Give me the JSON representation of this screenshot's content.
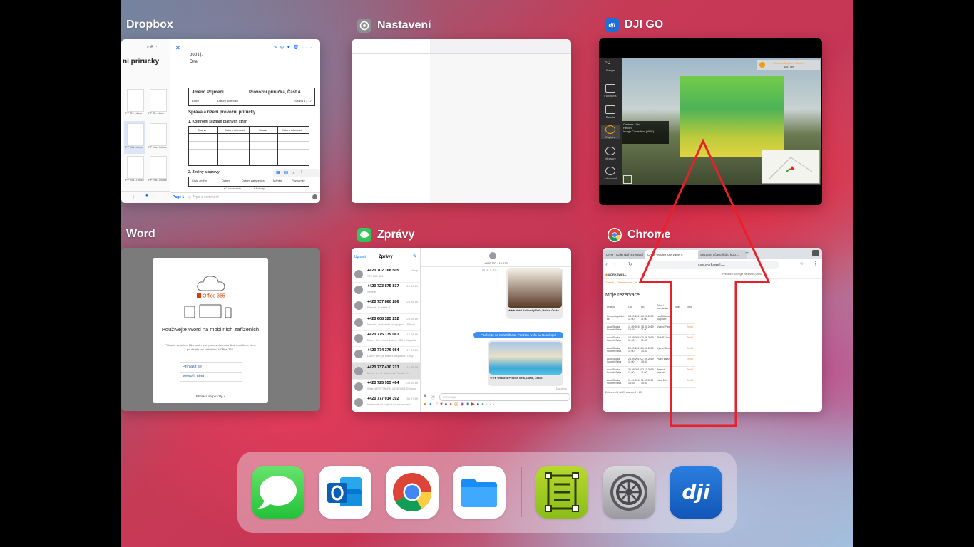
{
  "switcher": {
    "apps": [
      {
        "label": "Dropbox"
      },
      {
        "label": "Nastavení"
      },
      {
        "label": "DJI GO"
      },
      {
        "label": "Word"
      },
      {
        "label": "Zprávy"
      },
      {
        "label": "Chrome"
      }
    ]
  },
  "dropbox": {
    "folder_title": "ni prirucky",
    "field_podpis": "pod t.j.",
    "field_dne": "Dne",
    "doc_header_name": "Jméno Příjmení",
    "doc_header_title": "Provozní příručka, Část A",
    "doc_row_edition": "Edice",
    "doc_row_date": "Datum účinnosti",
    "doc_row_page": "Strana 1 z 17",
    "section_title": "Správa a řízení provozní příručky",
    "item_1": "1.     Kontrolní seznam platných stran",
    "table_headers": [
      "Strana",
      "Datum účinnosti",
      "Strana",
      "Datum účinnosti"
    ],
    "item_2": "2.     Změny a opravy",
    "table2_headers": [
      "Číslo změny",
      "Datum",
      "Datum zařazení a",
      "Měnění",
      "Poznámky"
    ],
    "thumbs": [
      "PP Č9...docx",
      "PP Čl...docx",
      "PP Ma...docx",
      "PP Ma...l.docx",
      "PP Ma...l.docx",
      "PP ma...l.docx"
    ],
    "bottom_page": "Page 1",
    "comment_placeholder": "Type a comment",
    "comments_label": "0 comments",
    "activity_label": "Activity"
  },
  "dji": {
    "side_items": [
      "Range",
      "Functions",
      "Palette",
      "Capture",
      "Measure",
      "Advanced"
    ],
    "warning_title": "Periodic Capture Started",
    "warning_sub": "Wo, Tiff",
    "info_lines": [
      "Capture : On",
      "Record",
      "Image Correction (NUC)"
    ],
    "temp_unit": "°C"
  },
  "word": {
    "office_label": "Office 365",
    "heading": "Používejte Word na mobilních zařízeních",
    "body": "Přihlaste se účtem Microsoft nebo pracovním nebo školním účtem, který používáte pro přihlášení k Office 365.",
    "signin": "Přihlásit se",
    "create": "Vytvořit účet",
    "later": "Přihlásit se později ›"
  },
  "messages": {
    "edit": "Upravit",
    "title": "Zprávy",
    "contact_number": "+420 737 410 213",
    "date_stamp": "po 16. 9. 20:...",
    "threads": [
      {
        "name": "+420 702 168 505",
        "date": "úterý",
        "preview": "725 856 464"
      },
      {
        "name": "+420 723 875 817",
        "date": "26.09.19",
        "preview": "Skvele"
      },
      {
        "name": "+420 737 860 286",
        "date": "26.09.19",
        "preview": "Přesně. Kontakt: 1"
      },
      {
        "name": "+420 608 325 252",
        "date": "23.09.19",
        "preview": "Nevadí, zustanete ve spojení... Pěkný večer, Z. Buchta"
      },
      {
        "name": "+420 775 139 061",
        "date": "17.09.19",
        "preview": "Dobrý den, moje jméno, 820 k dispozici? Dekuji"
      },
      {
        "name": "+420 774 376 084",
        "date": "17.09.19",
        "preview": "Dobrý den, je stále k dispozici? Díky"
      },
      {
        "name": "+420 737 410 213",
        "date": "16.09.19",
        "preview": "Mém. ★★★ Wellness Penzion I..."
      },
      {
        "name": "+420 725 955 464",
        "date": "05.09.19",
        "preview": "Web: 49°37'39.4\"N 15°30'08.1\"E (google.com)"
      },
      {
        "name": "+420 777 014 392",
        "date": "30.07.19",
        "preview": "Nechcete mi napsat na stránkami?"
      }
    ],
    "bubble_1_caption": "★★★ Hotel Královský Dvůr, Hořice, Česko",
    "bubble_blue": "Podívejte se na Wellness Penzion Ivela na Bookingu!",
    "bubble_2_caption": "★★★ Wellness Penzion Ivela, Zaoral, Česko",
    "delivered": "Doručeno",
    "input_placeholder": "iMessage"
  },
  "chrome": {
    "tabs": [
      "CRM - Kalendář rezervací",
      "CRM - Moje rezervace",
      "Seznam účastníků o kurz..."
    ],
    "url": "crm.workswell.cz",
    "brand": "WORKSWELL",
    "nav_links": [
      "Zasedi",
      "Rezervace",
      "K"
    ],
    "user_info": "Přihlášen: Georgie Nanovski (Odhlá",
    "page_title": "Moje rezervace",
    "table_headers": [
      "Přístroj",
      "Od",
      "Do",
      "Zdroj / poznámka",
      "Stav",
      "Zruš"
    ],
    "rows": [
      {
        "device": "Senzor teplotní 1 ks",
        "from": "04.09.2019 11:00",
        "to": "06.09.2019 11:00",
        "note": "zápůjčka na rozpočet"
      },
      {
        "device": "Auto Skoda Superb Sirka",
        "from": "11.09.2019 12:00",
        "to": "18.09.2019 11:00",
        "note": "Výjezd Plzeň"
      },
      {
        "device": "Auto Skoda Superb Sirka",
        "from": "18.09.2019 11:00",
        "to": "20.09.2019 11:00",
        "note": "TMMR Úvalno"
      },
      {
        "device": "Auto Skoda Superb Sirka",
        "from": "20.09.2019 11:00",
        "to": "20.09.2019 14:00",
        "note": "Výjezd Brno"
      },
      {
        "device": "Auto Skoda Superb Sirka",
        "from": "25.09.2019 11:00",
        "to": "27.09.2019 15:00",
        "note": "Plzeň zajezd"
      },
      {
        "device": "Auto Skoda Superb Sirka",
        "from": "30.09.2019 11:00",
        "to": "02.10.2019 11:00",
        "note": "Prvních zajezdů"
      },
      {
        "device": "Auto Skoda Superb Sirka",
        "from": "11.10.2019 15:00",
        "to": "11.10.2019 15:00",
        "note": "Libor 6 hz"
      }
    ],
    "status": "Zrušit",
    "footer": "Zobrazeni 1 až 23 záznamů z 23"
  },
  "dock": {
    "apps": [
      {
        "name": "Zprávy"
      },
      {
        "name": "Outlook"
      },
      {
        "name": "Chrome"
      },
      {
        "name": "Soubory"
      },
      {
        "name": "Plánovač"
      },
      {
        "name": "Nastavení"
      },
      {
        "name": "DJI GO"
      }
    ]
  },
  "colors": {
    "annotation_arrow": "#e8202a",
    "dropbox_blue": "#0061fe",
    "messages_green": "#34c759",
    "dji_blue": "#1e6fd9",
    "crm_orange": "#f28c28"
  }
}
